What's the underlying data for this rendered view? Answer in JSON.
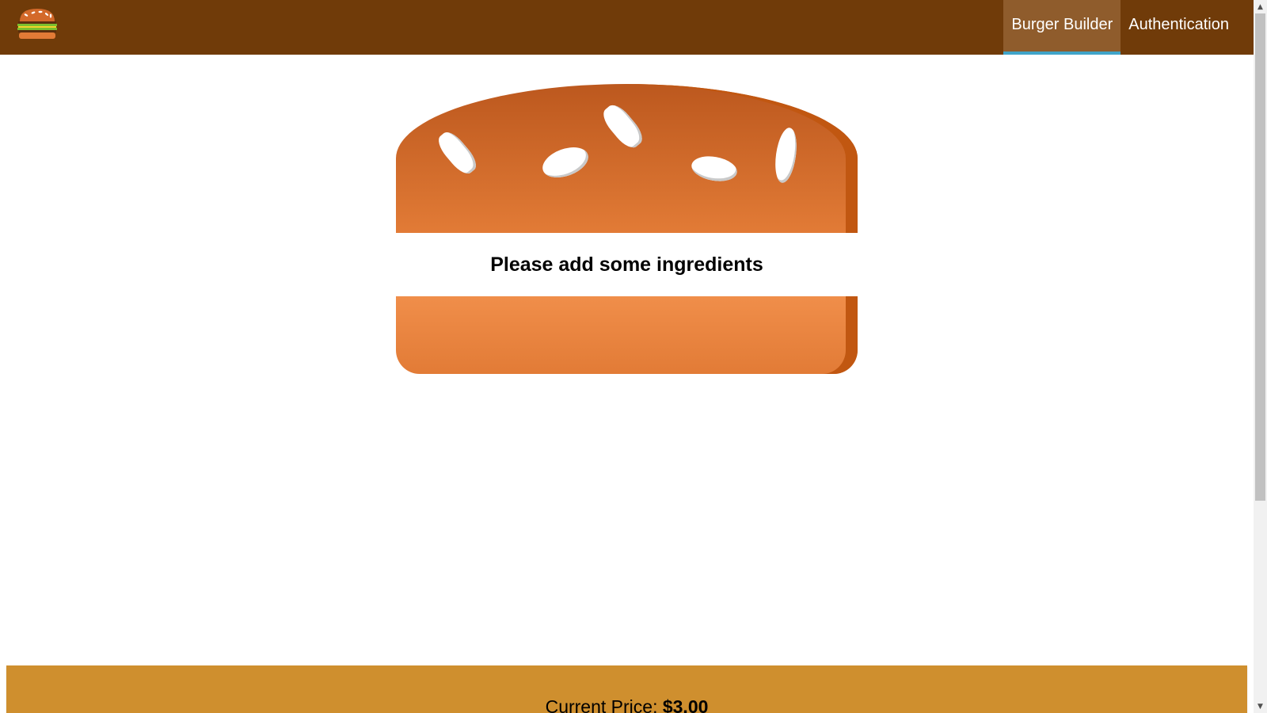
{
  "toolbar": {
    "logo_icon": "burger-logo-icon",
    "background": "#703B09",
    "nav": [
      {
        "label": "Burger Builder",
        "active": true
      },
      {
        "label": "Authentication",
        "active": false
      }
    ],
    "active_background": "#8F5C2C",
    "active_underline": "#40A4C8"
  },
  "burger": {
    "message": "Please add some ingredients",
    "bread_color": "#e27b36"
  },
  "build_controls": {
    "price_label": "Current Price: ",
    "price_value": "$3.00",
    "background": "#CF8F2E"
  },
  "scrollbar": {
    "up_icon": "scroll-up-arrow-icon",
    "down_icon": "scroll-down-arrow-icon"
  }
}
